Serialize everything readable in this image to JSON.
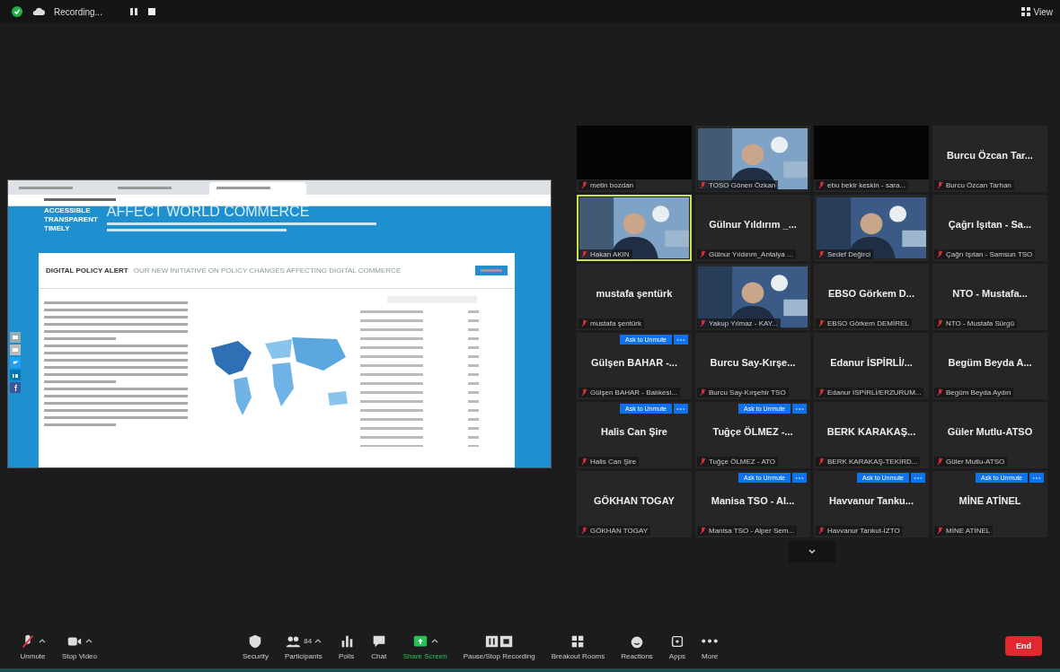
{
  "top_bar": {
    "recording_label": "Recording...",
    "view_label": "View"
  },
  "shared_screen": {
    "browser_tabs": [
      {
        "selected": false
      },
      {
        "selected": false
      },
      {
        "selected": true
      }
    ],
    "features": [
      "ACCESSIBLE",
      "TRANSPARENT",
      "TIMELY"
    ],
    "hero_title": "AFFECT WORLD COMMERCE",
    "alert_title": "DIGITAL POLICY ALERT",
    "alert_subtitle": "OUR NEW INITIATIVE ON POLICY CHANGES AFFECTING DIGITAL COMMERCE"
  },
  "tiles": [
    {
      "kind": "blank",
      "label": "metin bozdan",
      "speaking": false,
      "ask_unmute": false
    },
    {
      "kind": "video",
      "label": "TOSO Gönen Özkan",
      "speaking": false,
      "ask_unmute": false
    },
    {
      "kind": "blank",
      "label": "ebu bekir keskin - sara...",
      "speaking": false,
      "ask_unmute": false
    },
    {
      "kind": "name",
      "display_name": "Burcu Özcan Tar...",
      "label": "Burcu Özcan Tarhan",
      "speaking": false,
      "ask_unmute": false
    },
    {
      "kind": "video",
      "label": "Hakan AKIN",
      "speaking": true,
      "ask_unmute": false
    },
    {
      "kind": "name",
      "display_name": "Gülnur Yıldırım _...",
      "label": "Gülnur Yıldırım_Antalya ...",
      "speaking": false,
      "ask_unmute": false
    },
    {
      "kind": "video",
      "label": "Sedef Değirci",
      "speaking": false,
      "ask_unmute": false
    },
    {
      "kind": "name",
      "display_name": "Çağrı Işıtan - Sa...",
      "label": "Çağrı Işıtan - Samsun TSO",
      "speaking": false,
      "ask_unmute": false
    },
    {
      "kind": "name",
      "display_name": "mustafa şentürk",
      "label": "mustafa şentürk",
      "speaking": false,
      "ask_unmute": false
    },
    {
      "kind": "video",
      "label": "Yakup Yılmaz - KAY...",
      "speaking": false,
      "ask_unmute": false
    },
    {
      "kind": "name",
      "display_name": "EBSO Görkem D...",
      "label": "EBSO Görkem DEMİREL",
      "speaking": false,
      "ask_unmute": false
    },
    {
      "kind": "name",
      "display_name": "NTO - Mustafa...",
      "label": "NTO - Mustafa Sürgü",
      "speaking": false,
      "ask_unmute": false
    },
    {
      "kind": "name",
      "display_name": "Gülşen BAHAR -...",
      "label": "Gülşen BAHAR - Balıkesi...",
      "speaking": false,
      "ask_unmute": "Ask to Unmute"
    },
    {
      "kind": "name",
      "display_name": "Burcu Say-Kırşe...",
      "label": "Burcu Say-Kırşehir TSO",
      "speaking": false,
      "ask_unmute": false
    },
    {
      "kind": "name",
      "display_name": "Edanur İSPİRLİ/...",
      "label": "Edanur İSPİRLİ/ERZURUM...",
      "speaking": false,
      "ask_unmute": false
    },
    {
      "kind": "name",
      "display_name": "Begüm Beyda A...",
      "label": "Begüm Beyda Aydın",
      "speaking": false,
      "ask_unmute": false
    },
    {
      "kind": "name",
      "display_name": "Halis Can Şire",
      "label": "Halis Can Şire",
      "speaking": false,
      "ask_unmute": "Ask to Unmute"
    },
    {
      "kind": "name",
      "display_name": "Tuğçe ÖLMEZ -...",
      "label": "Tuğçe ÖLMEZ - ATO",
      "speaking": false,
      "ask_unmute": "Ask to Unmute"
    },
    {
      "kind": "name",
      "display_name": "BERK KARAKAŞ...",
      "label": "BERK KARAKAŞ-TEKİRD...",
      "speaking": false,
      "ask_unmute": false
    },
    {
      "kind": "name",
      "display_name": "Güler Mutlu-ATSO",
      "label": "Güler Mutlu-ATSO",
      "speaking": false,
      "ask_unmute": false
    },
    {
      "kind": "name",
      "display_name": "GÖKHAN TOGAY",
      "label": "GÖKHAN TOGAY",
      "speaking": false,
      "ask_unmute": false
    },
    {
      "kind": "name",
      "display_name": "Manisa TSO - Al...",
      "label": "Manisa TSO - Alper Sem...",
      "speaking": false,
      "ask_unmute": "Ask to Unmute"
    },
    {
      "kind": "name",
      "display_name": "Havvanur Tanku...",
      "label": "Havvanur Tankut-İZTO",
      "speaking": false,
      "ask_unmute": "Ask to Unmute"
    },
    {
      "kind": "name",
      "display_name": "MİNE ATİNEL",
      "label": "MİNE ATİNEL",
      "speaking": false,
      "ask_unmute": "Ask to Unmute"
    }
  ],
  "toolbar": [
    {
      "kind": "mic_off",
      "label": "Unmute",
      "caret": true
    },
    {
      "kind": "video",
      "label": "Stop Video",
      "caret": true
    },
    {
      "kind": "gap"
    },
    {
      "kind": "shield",
      "label": "Security",
      "caret": false
    },
    {
      "kind": "participants",
      "label": "Participants",
      "count": "84",
      "caret": true
    },
    {
      "kind": "polls",
      "label": "Polls",
      "caret": false
    },
    {
      "kind": "chat",
      "label": "Chat",
      "caret": false
    },
    {
      "kind": "share",
      "label": "Share Screen",
      "caret": true,
      "accent": true
    },
    {
      "kind": "record",
      "label": "Pause/Stop Recording",
      "caret": false
    },
    {
      "kind": "breakout",
      "label": "Breakout Rooms",
      "caret": false
    },
    {
      "kind": "reactions",
      "label": "Reactions",
      "caret": false
    },
    {
      "kind": "apps",
      "label": "Apps",
      "caret": false
    },
    {
      "kind": "more",
      "label": "More",
      "caret": false
    }
  ],
  "end_label": "End"
}
